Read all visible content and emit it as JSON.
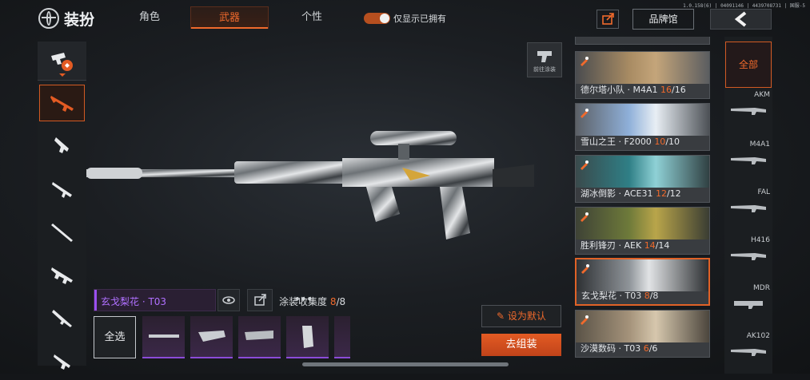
{
  "version": "1.0.158(6) | 04091146 | 4439708731 | 国服-5",
  "header": {
    "title": "装扮",
    "tabs": [
      {
        "label": "角色",
        "active": false
      },
      {
        "label": "武器",
        "active": true
      },
      {
        "label": "个性",
        "active": false
      }
    ],
    "toggle_label": "仅显示已拥有",
    "toggle_on": true,
    "brand_button": "品牌馆"
  },
  "categories": [
    "equipment-icon",
    "assault-rifle-icon",
    "smg-icon",
    "shotgun-icon",
    "sniper-icon",
    "lmg-icon",
    "marksman-icon",
    "pistol-icon"
  ],
  "weapon_view": {
    "goto_paint_label": "前往涂装"
  },
  "skin_bar": {
    "skin_name": "玄戈梨花 · T03",
    "collection_label": "涂装收集度",
    "collection_owned": "8",
    "collection_total": "/8",
    "select_all": "全选",
    "set_default": "设为默认",
    "go_assemble": "去组装"
  },
  "skin_list": [
    {
      "name": "德尔塔小队 · M4A1 ",
      "owned": "16",
      "total": "/16",
      "selected": false
    },
    {
      "name": "雪山之王 · F2000 ",
      "owned": "10",
      "total": "/10",
      "selected": false
    },
    {
      "name": "湖冰倒影 · ACE31 ",
      "owned": "12",
      "total": "/12",
      "selected": false
    },
    {
      "name": "胜利锋刃 · AEK ",
      "owned": "14",
      "total": "/14",
      "selected": false
    },
    {
      "name": "玄戈梨花 · T03 ",
      "owned": "8",
      "total": "/8",
      "selected": true
    },
    {
      "name": "沙漠数码 · T03 ",
      "owned": "6",
      "total": "/6",
      "selected": false
    }
  ],
  "models": {
    "all_label": "全部",
    "items": [
      "AKM",
      "M4A1",
      "FAL",
      "H416",
      "MDR",
      "AK102"
    ]
  },
  "colors": {
    "accent": "#f06a2c",
    "rarity_purple": "#9a4ff0"
  }
}
